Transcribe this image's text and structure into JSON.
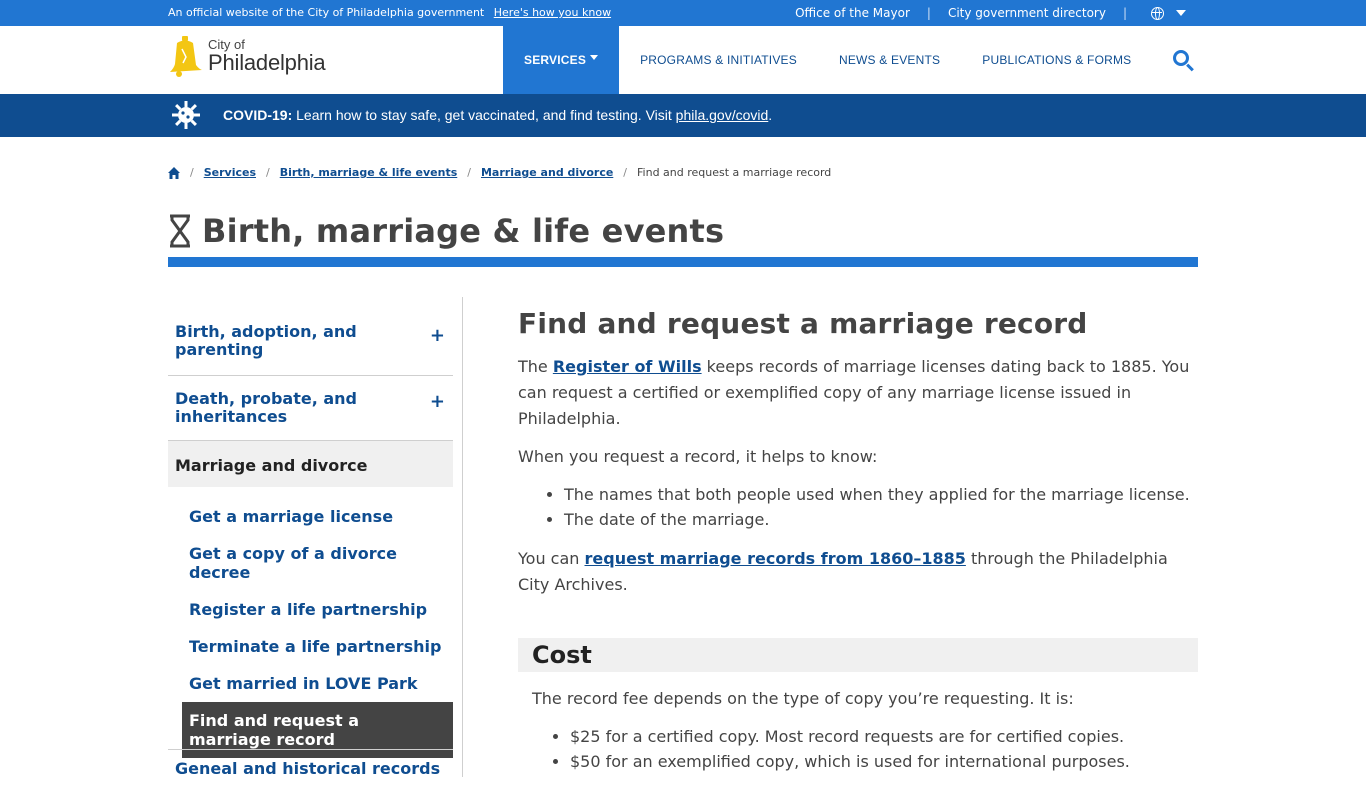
{
  "gov_bar": {
    "official_text": "An official website of the City of Philadelphia government",
    "how_link": "Here's how you know",
    "links": [
      "Office of the Mayor",
      "City government directory"
    ],
    "separator": "|"
  },
  "header": {
    "logo_city": "City of",
    "logo_name": "Philadelphia",
    "nav": [
      "SERVICES",
      "PROGRAMS & INITIATIVES",
      "NEWS & EVENTS",
      "PUBLICATIONS & FORMS"
    ],
    "active_nav": "SERVICES"
  },
  "covid_banner": {
    "bold": "COVID-19:",
    "text": " Learn how to stay safe, get vaccinated, and find testing. Visit ",
    "link": "phila.gov/covid",
    "end": "."
  },
  "breadcrumb": {
    "links": [
      "Services",
      "Birth, marriage & life events",
      "Marriage and divorce"
    ],
    "current": "Find and request a marriage record",
    "separator": "/"
  },
  "page_title": "Birth, marriage & life events",
  "sidenav": {
    "sections": [
      {
        "label": "Birth, adoption, and parenting",
        "toggle": "+"
      },
      {
        "label": "Death, probate, and inheritances",
        "toggle": "+"
      }
    ],
    "current_section": "Marriage and divorce",
    "sub_items": [
      "Get a marriage license",
      "Get a copy of a divorce decree",
      "Register a life partnership",
      "Terminate a life partnership",
      "Get married in LOVE Park",
      "Find and request a marriage record"
    ],
    "active_sub": "Find and request a marriage record",
    "next_section_partial": "Geneal and historical records"
  },
  "main": {
    "heading": "Find and request a marriage record",
    "p1_pre": "The ",
    "p1_link": "Register of Wills",
    "p1_post": " keeps records of marriage licenses dating back to 1885. You can request a certified or exemplified copy of any marriage license issued in Philadelphia.",
    "p2": "When you request a record, it helps to know:",
    "list1": [
      "The names that both people used when they applied for the marriage license.",
      "The date of the marriage."
    ],
    "p3_pre": "You can ",
    "p3_link": "request marriage records from 1860–1885",
    "p3_post": " through the Philadelphia City Archives.",
    "cost_heading": "Cost",
    "cost_p": "The record fee depends on the type of copy you’re requesting. It is:",
    "cost_list": [
      "$25 for a certified copy. Most record requests are for certified copies.",
      "$50 for an exemplified copy, which is used for international purposes."
    ]
  },
  "colors": {
    "brand_blue": "#2176d2",
    "dark_blue": "#0f4d90",
    "bell_yellow": "#f3c613",
    "text": "#444444"
  }
}
